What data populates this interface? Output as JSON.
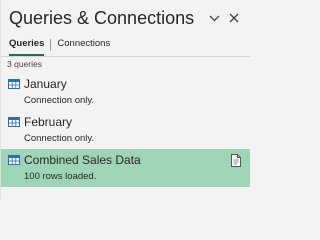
{
  "pane": {
    "title": "Queries & Connections",
    "options_icon": "chevron-down-icon",
    "close_icon": "close-icon"
  },
  "tabs": [
    {
      "label": "Queries",
      "active": true
    },
    {
      "label": "Connections",
      "active": false
    }
  ],
  "query_count": "3 queries",
  "queries": [
    {
      "name": "January",
      "status": "Connection only.",
      "selected": false,
      "icon": "table-icon"
    },
    {
      "name": "February",
      "status": "Connection only.",
      "selected": false,
      "icon": "table-icon"
    },
    {
      "name": "Combined Sales Data",
      "status": "100 rows loaded.",
      "selected": true,
      "icon": "table-icon",
      "side_icon": "document-icon"
    }
  ],
  "colors": {
    "accent": "#217346",
    "selected_background": "#9fd5b7",
    "pane_background": "#f3f3f3",
    "icon_blue": "#2b6fb5"
  }
}
